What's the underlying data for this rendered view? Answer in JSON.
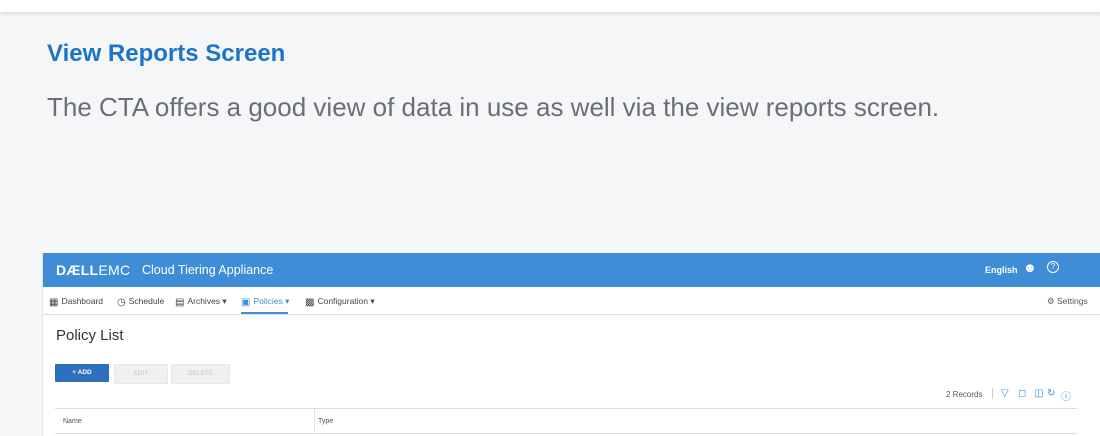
{
  "article": {
    "title": "View Reports Screen",
    "description": "The CTA offers a good view of data in use as well via the view reports screen."
  },
  "app": {
    "brand_dell": "DÆLL",
    "brand_emc": "EMC",
    "name": "Cloud Tiering Appliance",
    "language": "English",
    "accent_color": "#3e8dd6"
  },
  "nav": {
    "items": [
      {
        "label": "Dashboard",
        "icon": "dashboard-icon"
      },
      {
        "label": "Schedule",
        "icon": "clock-icon"
      },
      {
        "label": "Archives ▾",
        "icon": "archive-icon"
      },
      {
        "label": "Policies ▾",
        "icon": "policy-icon",
        "active": true
      },
      {
        "label": "Configuration ▾",
        "icon": "config-icon"
      }
    ],
    "settings_label": "Settings"
  },
  "page": {
    "title": "Policy List",
    "add_label": "+ ADD",
    "edit_label": "EDIT",
    "delete_label": "DELETE",
    "records_label": "2 Records"
  },
  "table": {
    "columns": [
      "Name",
      "Type"
    ]
  }
}
